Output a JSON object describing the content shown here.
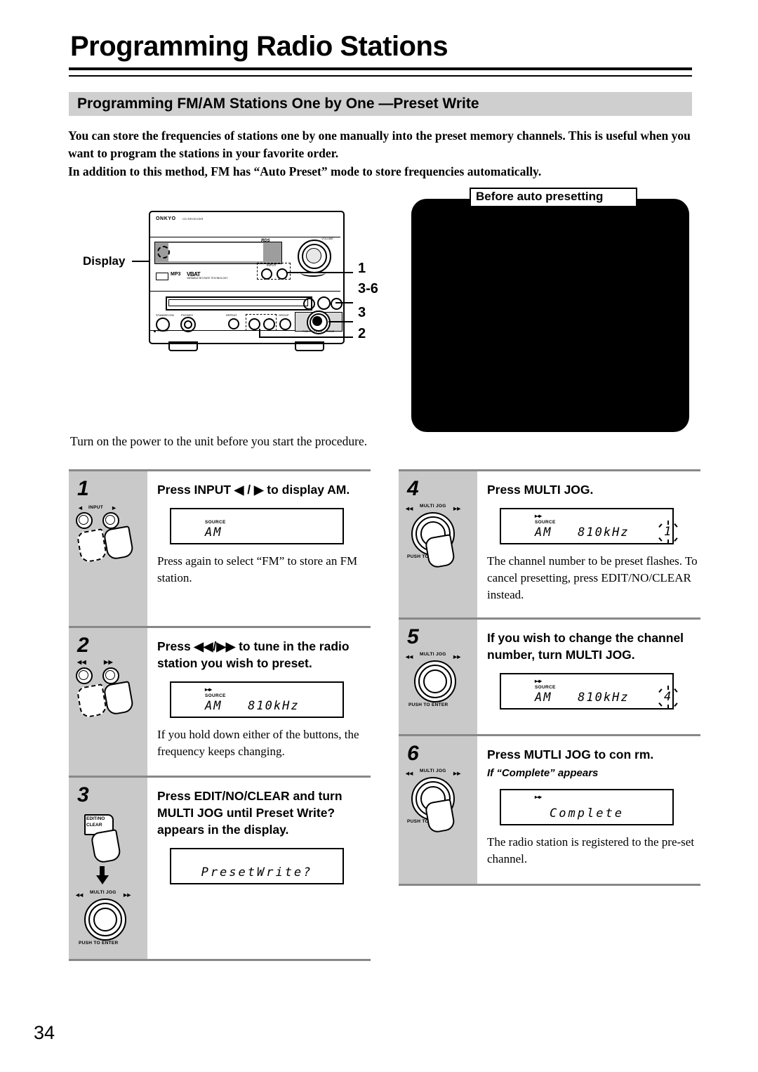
{
  "page": {
    "title": "Programming Radio Stations",
    "section_title": "Programming FM/AM Stations One by One —Preset Write",
    "number": "34"
  },
  "intro": {
    "paragraph_1": "You can store the frequencies of stations one by one manually into the preset memory channels. This is useful when you want to program the stations in your favorite order.",
    "paragraph_2": "In addition to this method, FM has “Auto Preset” mode to store frequencies automatically.",
    "paragraph_3": "Turn on the power to the unit before you start the procedure."
  },
  "diagram": {
    "display_label": "Display",
    "brand": "ONKYO",
    "brand_sub": "CD RECEIVER",
    "rds_label": "RDS",
    "volume_label": "VOLUME",
    "mp3_label": "MP3",
    "vbat_label": "VBAT",
    "vbat_sub": "VARIABLE BIT-RATE TECHNOLOGY",
    "input_label": "INPUT",
    "standby_on_label": "STANDBY/ON",
    "standby_label": "STANDBY",
    "phones_label": "PHONES",
    "repeat_label": "REPEAT",
    "group_label": "GROUP",
    "jog_push_label": "PUSH TO ENTER",
    "jog_right_label": "OK/NO",
    "callouts": [
      "1",
      "3-6",
      "3",
      "2"
    ]
  },
  "callout_box": {
    "title": "Before auto presetting"
  },
  "steps": [
    {
      "num": "1",
      "head": "Press INPUT ◀ / ▶ to display AM.",
      "body": "Press again to select “FM” to store an FM station.",
      "button_label": "INPUT",
      "lcd": {
        "source": "SOURCE",
        "main": "AM",
        "arrows": "",
        "channel": ""
      }
    },
    {
      "num": "2",
      "head": "Press ◀◀/▶▶ to tune in the radio station you wish to preset.",
      "body": "If you hold down either of the buttons, the frequency keeps changing.",
      "button_left_label": "◀◀",
      "button_right_label": "▶▶",
      "lcd": {
        "source": "SOURCE",
        "main": "AM   810kHz",
        "arrows": "▸◂▸",
        "channel": ""
      }
    },
    {
      "num": "3",
      "head": "Press EDIT/NO/CLEAR and turn MULTI JOG until  Preset Write? appears in the display.",
      "body": "",
      "button_label_line1": "EDIT/NO",
      "button_label_line2": "CLEAR",
      "jog_label": "MULTI JOG",
      "jog_push": "PUSH TO ENTER",
      "lcd": {
        "source": "",
        "main": "PresetWrite?",
        "arrows": "",
        "channel": ""
      }
    },
    {
      "num": "4",
      "head": "Press MULTI JOG.",
      "body": "The channel number to be preset flashes. To cancel presetting, press EDIT/NO/CLEAR instead.",
      "jog_label": "MULTI JOG",
      "jog_push": "PUSH TO",
      "lcd": {
        "source": "SOURCE",
        "main": "AM   810kHz",
        "arrows": "▸◂▸",
        "channel": "1"
      }
    },
    {
      "num": "5",
      "head": "If you wish to change the channel number, turn MULTI JOG.",
      "body": "",
      "jog_label": "MULTI JOG",
      "jog_push": "PUSH TO ENTER",
      "lcd": {
        "source": "SOURCE",
        "main": "AM   810kHz",
        "arrows": "▸◂▸",
        "channel": "4"
      }
    },
    {
      "num": "6",
      "head": "Press MUTLI JOG to con rm.",
      "sub": "If “Complete” appears",
      "body": "The radio station is registered to the pre-set channel.",
      "jog_label": "MULTI JOG",
      "jog_push": "PUSH TO",
      "lcd": {
        "source": "",
        "main": "Complete",
        "arrows": "▸◂▸",
        "channel": ""
      }
    }
  ],
  "colors": {
    "section_bar": "#cfcfcf",
    "step_column": "#c9c9c9",
    "rule": "#888888",
    "black_box": "#000000"
  }
}
